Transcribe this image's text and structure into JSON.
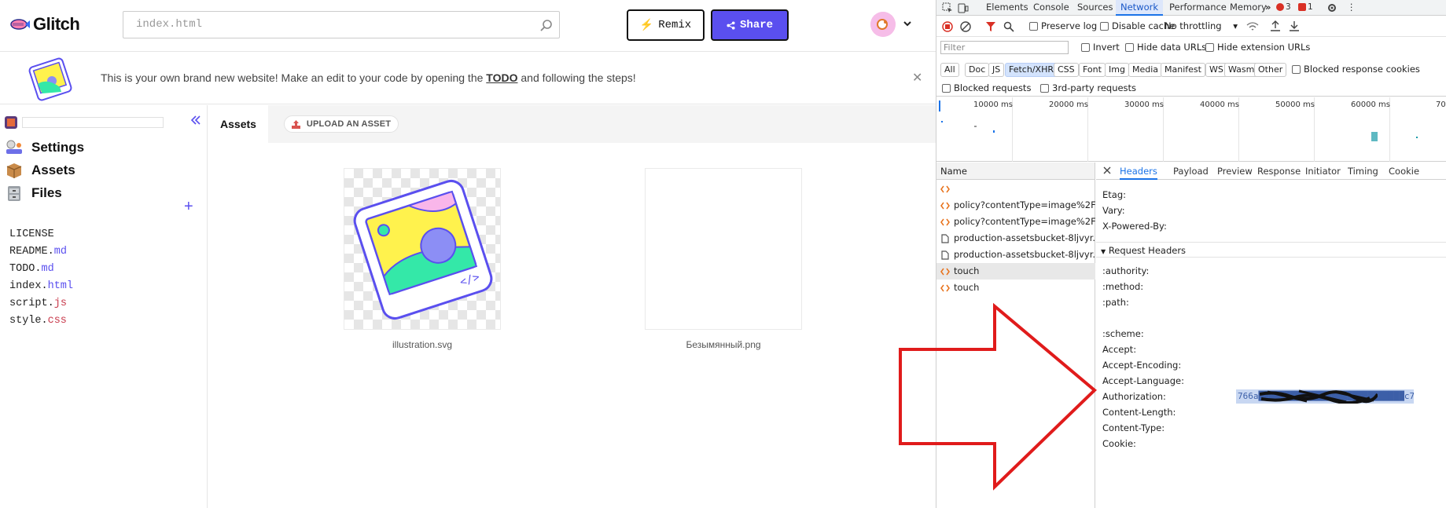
{
  "glitch": {
    "logo_text": "Glitch",
    "search_value": "index.html",
    "remix_label": "Remix",
    "share_label": "Share",
    "banner": {
      "text_before": "This is your own brand new website! Make an edit to your code by opening the ",
      "link": "TODO",
      "text_after": " and following the steps!"
    },
    "sidebar": {
      "items": [
        {
          "label": "Settings",
          "icon": "settings-icon"
        },
        {
          "label": "Assets",
          "icon": "box-icon"
        },
        {
          "label": "Files",
          "icon": "file-cabinet-icon"
        }
      ],
      "files": [
        {
          "base": "LICENSE",
          "ext": ""
        },
        {
          "base": "README.",
          "ext": "md"
        },
        {
          "base": "TODO.",
          "ext": "md"
        },
        {
          "base": "index.",
          "ext": "html"
        },
        {
          "base": "script.",
          "ext": "js"
        },
        {
          "base": "style.",
          "ext": "css"
        }
      ]
    },
    "main": {
      "tab": "Assets",
      "upload_label": "UPLOAD AN ASSET",
      "assets": [
        {
          "name": "illustration.svg"
        },
        {
          "name": "Безымянный.png"
        }
      ]
    }
  },
  "devtools": {
    "tabs": [
      "Elements",
      "Console",
      "Sources",
      "Network",
      "Performance",
      "Memory"
    ],
    "active_tab": "Network",
    "error_count": "3",
    "issue_count": "1",
    "toolbar": {
      "preserve_log": "Preserve log",
      "disable_cache": "Disable cache",
      "throttling": "No throttling"
    },
    "filter": {
      "placeholder": "Filter",
      "invert": "Invert",
      "hide_data_urls": "Hide data URLs",
      "hide_extension_urls": "Hide extension URLs"
    },
    "type_filters": [
      "All",
      "Doc",
      "JS",
      "Fetch/XHR",
      "CSS",
      "Font",
      "Img",
      "Media",
      "Manifest",
      "WS",
      "Wasm",
      "Other"
    ],
    "active_type_filter": "Fetch/XHR",
    "blocked_response_cookies": "Blocked response cookies",
    "blocked_requests": "Blocked requests",
    "third_party_requests": "3rd-party requests",
    "timeline_ticks": [
      "10000 ms",
      "20000 ms",
      "30000 ms",
      "40000 ms",
      "50000 ms",
      "60000 ms",
      "70"
    ],
    "name_header": "Name",
    "requests": [
      {
        "name": "",
        "type": "xhr"
      },
      {
        "name": "policy?contentType=image%2F...",
        "type": "xhr"
      },
      {
        "name": "policy?contentType=image%2F...",
        "type": "xhr"
      },
      {
        "name": "production-assetsbucket-8ljvyr...",
        "type": "doc"
      },
      {
        "name": "production-assetsbucket-8ljvyr...",
        "type": "doc"
      },
      {
        "name": "touch",
        "type": "xhr",
        "selected": true
      },
      {
        "name": "touch",
        "type": "xhr"
      }
    ],
    "detail_tabs": [
      "Headers",
      "Payload",
      "Preview",
      "Response",
      "Initiator",
      "Timing",
      "Cookie"
    ],
    "active_detail_tab": "Headers",
    "response_headers": [
      "Etag:",
      "Vary:",
      "X-Powered-By:"
    ],
    "request_headers_title": "Request Headers",
    "request_headers": [
      ":authority:",
      ":method:",
      ":path:",
      "",
      ":scheme:",
      "Accept:",
      "Accept-Encoding:",
      "Accept-Language:",
      "Authorization:",
      "Content-Length:",
      "Content-Type:",
      "Cookie:"
    ],
    "authorization_value_visible": "766a████████████████████████████c7d4114c4"
  }
}
